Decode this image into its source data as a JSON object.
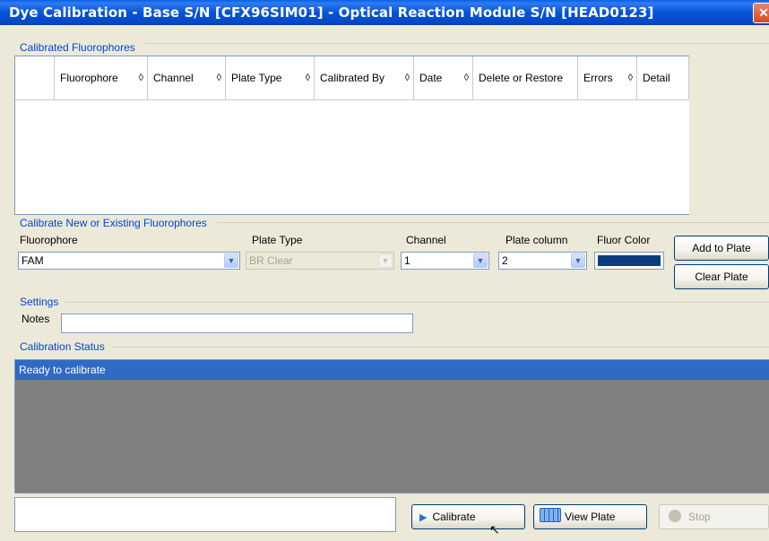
{
  "window": {
    "title": "Dye Calibration - Base S/N [CFX96SIM01] - Optical Reaction Module S/N [HEAD0123]",
    "close_glyph": "✕"
  },
  "calibrated_fluorophores": {
    "group_label": "Calibrated Fluorophores",
    "columns": [
      "Fluorophore",
      "Channel",
      "Plate Type",
      "Calibrated By",
      "Date",
      "Delete or Restore",
      "Errors",
      "Detail"
    ],
    "sort_glyph": "◊",
    "rows": []
  },
  "calibrate_new": {
    "group_label": "Calibrate New or Existing Fluorophores",
    "fluorophore_label": "Fluorophore",
    "fluorophore_value": "FAM",
    "plate_type_label": "Plate Type",
    "plate_type_value": "BR Clear",
    "channel_label": "Channel",
    "channel_value": "1",
    "plate_column_label": "Plate column",
    "plate_column_value": "2",
    "fluor_color_label": "Fluor Color",
    "fluor_color": "#0b3c7e",
    "add_to_plate_label": "Add to Plate",
    "clear_plate_label": "Clear Plate"
  },
  "settings": {
    "group_label": "Settings",
    "notes_label": "Notes",
    "notes_value": ""
  },
  "calibration_status": {
    "group_label": "Calibration Status",
    "status_text": "Ready to calibrate"
  },
  "footer": {
    "calibrate_label": "Calibrate",
    "view_plate_label": "View Plate",
    "stop_label": "Stop"
  },
  "colors": {
    "titlebar": "#0553d8",
    "group_label": "#0046d5",
    "selection": "#316ac5",
    "status_bg": "#808080"
  }
}
